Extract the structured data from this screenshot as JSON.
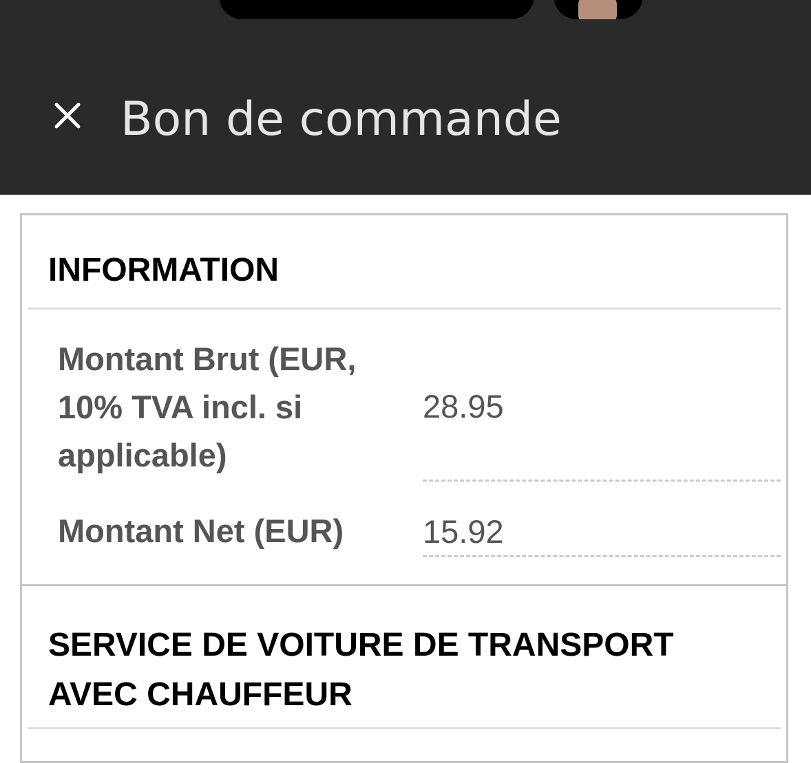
{
  "header": {
    "title": "Bon de commande",
    "close_icon": "close-icon",
    "background": "#2a2a2a"
  },
  "information": {
    "title": "INFORMATION",
    "rows": [
      {
        "label": "Montant Brut (EUR, 10% TVA incl. si applicable)",
        "value": "28.95"
      },
      {
        "label": "Montant Net (EUR)",
        "value": "15.92"
      }
    ]
  },
  "service": {
    "title": "SERVICE DE VOITURE DE TRANSPORT AVEC CHAUFFEUR"
  }
}
